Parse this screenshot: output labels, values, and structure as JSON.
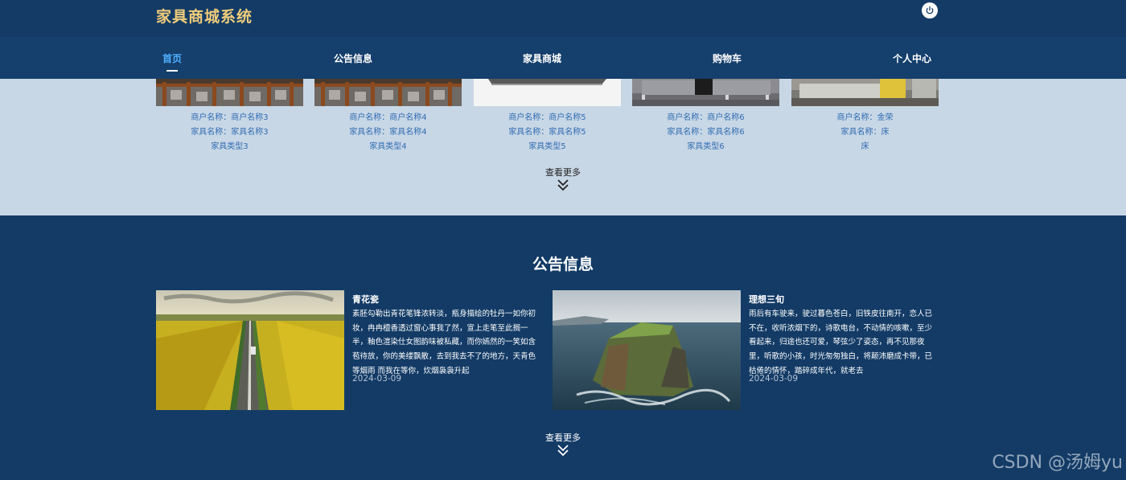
{
  "header": {
    "brand": "家具商城系统",
    "power_icon": "power-icon"
  },
  "nav": {
    "items": [
      {
        "label": "首页",
        "active": true
      },
      {
        "label": "公告信息",
        "active": false
      },
      {
        "label": "家具商城",
        "active": false
      },
      {
        "label": "购物车",
        "active": false
      },
      {
        "label": "个人中心",
        "active": false
      }
    ]
  },
  "products": {
    "items": [
      {
        "merchant": "商户名称：商户名称3",
        "name": "家具名称：家具名称3",
        "type": "家具类型3"
      },
      {
        "merchant": "商户名称：商户名称4",
        "name": "家具名称：家具名称4",
        "type": "家具类型4"
      },
      {
        "merchant": "商户名称：商户名称5",
        "name": "家具名称：家具名称5",
        "type": "家具类型5"
      },
      {
        "merchant": "商户名称：商户名称6",
        "name": "家具名称：家具名称6",
        "type": "家具类型6"
      },
      {
        "merchant": "商户名称：金荣",
        "name": "家具名称：床",
        "type": "床"
      }
    ],
    "more_label": "查看更多"
  },
  "notices": {
    "title": "公告信息",
    "items": [
      {
        "title": "青花瓷",
        "body": "素胚勾勒出青花笔锋浓转淡，瓶身描绘的牡丹一如你初妆，冉冉檀香透过窗心事我了然，宣上走笔至此搁一半，釉色渲染仕女图韵味被私藏，而你嫣然的一笑如含苞待放，你的美缕飘散，去到我去不了的地方，天青色等烟雨 而我在等你，炊烟袅袅升起",
        "date": "2024-03-09"
      },
      {
        "title": "理想三旬",
        "body": "雨后有车驶来，驶过暮色苍白，旧铁皮往南开，恋人已不在，收听浓烟下的，诗歌电台，不动情的咳嗽，至少看起来，归途也还可爱，琴弦少了姿态，再不见那夜里，听歌的小孩，时光匆匆独白，将颠沛磨成卡带，已枯倦的情怀，踏碎成年代，就老去",
        "date": "2024-03-09"
      }
    ],
    "more_label": "查看更多"
  },
  "watermark": "CSDN @汤姆yu",
  "colors": {
    "header_bg": "#133b66",
    "brand": "#f0cc7a",
    "nav_active": "#4fb0ff",
    "product_bg": "#c8d7e6",
    "product_text": "#2f6cb2"
  }
}
